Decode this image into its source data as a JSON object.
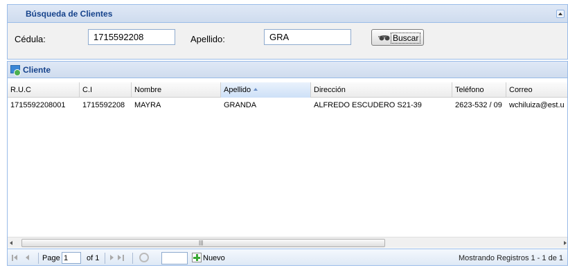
{
  "search_panel": {
    "title": "Búsqueda de Clientes",
    "cedula_label": "Cédula:",
    "cedula_value": "1715592208",
    "apellido_label": "Apellido:",
    "apellido_value": "GRA",
    "search_button": "Buscar"
  },
  "grid": {
    "title": "Cliente",
    "columns": [
      "R.U.C",
      "C.I",
      "Nombre",
      "Apellido",
      "Dirección",
      "Teléfono",
      "Correo"
    ],
    "sorted_column": "Apellido",
    "sort_direction": "asc",
    "rows": [
      [
        "1715592208001",
        "1715592208",
        "MAYRA",
        "GRANDA",
        "ALFREDO ESCUDERO S21-39",
        "2623-532 / 09",
        "wchiluiza@est.u"
      ]
    ]
  },
  "pager": {
    "page_label": "Page",
    "page_value": "1",
    "of_label": "of 1",
    "new_label": "Nuevo",
    "status": "Mostrando Registros 1 - 1 de 1"
  },
  "icons": {
    "search_button_icon": "binoculars-icon",
    "grid_icon": "table-icon",
    "add_icon": "add-icon",
    "refresh_icon": "refresh-icon"
  }
}
